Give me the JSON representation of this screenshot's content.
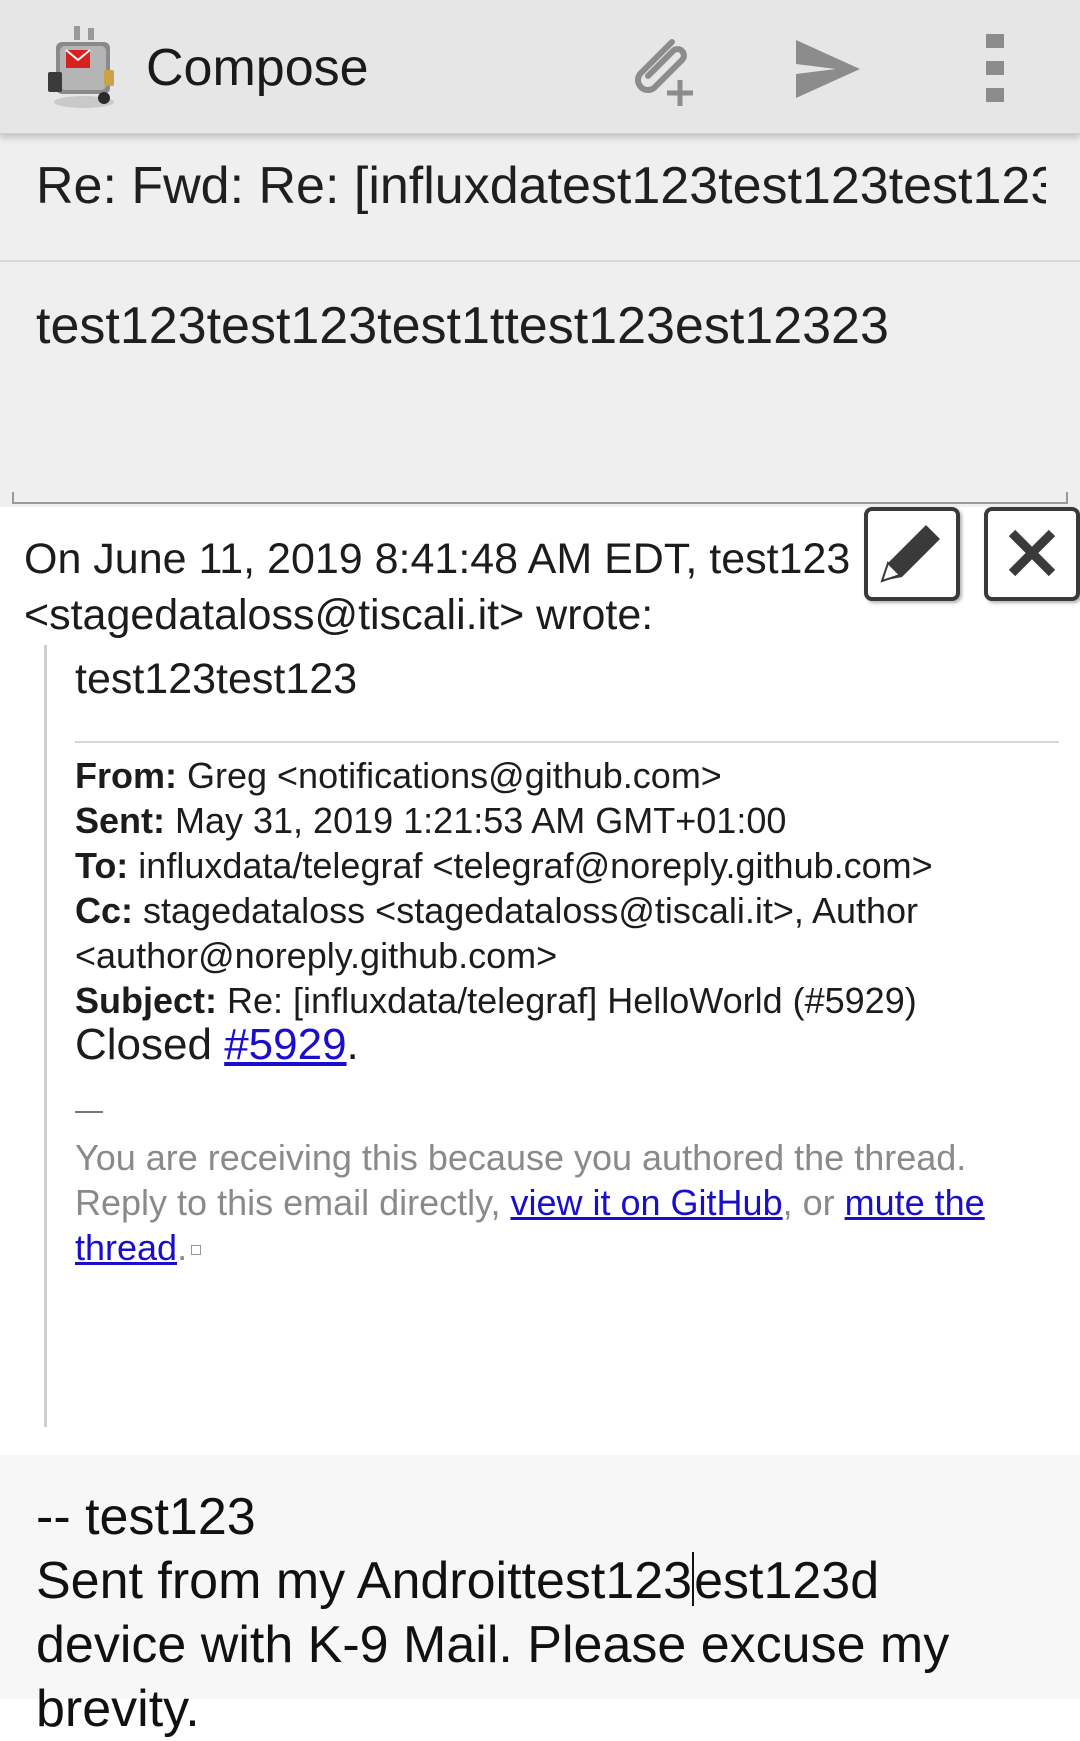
{
  "appbar": {
    "title": "Compose",
    "icons": {
      "app": "k9-mail-robot-icon",
      "attach": "attach-plus-icon",
      "send": "send-icon",
      "more": "more-vert-icon"
    }
  },
  "subject": {
    "value": "Re: Fwd: Re: [influxdatest123test123test123"
  },
  "body": {
    "value": "test123test123test1ttest123est12323"
  },
  "quote": {
    "header_line1": "On June 11, 2019 8:41:48 AM EDT, test123",
    "header_line2": "<stagedataloss@tiscali.it> wrote:",
    "first_line": "test123test123",
    "from_label": "From:",
    "from_value": " Greg <notifications@github.com>",
    "sent_label": "Sent:",
    "sent_value": " May 31, 2019 1:21:53 AM GMT+01:00",
    "to_label": "To:",
    "to_value": " influxdata/telegraf <telegraf@noreply.github.com>",
    "cc_label": "Cc:",
    "cc_value_line1": " stagedataloss <stagedataloss@tiscali.it>, Author",
    "cc_value_line2": "<author@noreply.github.com>",
    "subject_label": "Subject:",
    "subject_value": " Re: [influxdata/telegraf] HelloWorld (#5929)",
    "closed_prefix": "Closed ",
    "closed_link": "#5929",
    "closed_suffix": ".",
    "note_line1": "You are receiving this because you authored the thread.",
    "note_line2_prefix": "Reply to this email directly, ",
    "note_link1": "view it on GitHub",
    "note_middle": ", or ",
    "note_link2a": "mute the",
    "note_link2b": "thread",
    "note_end": "."
  },
  "signature": {
    "line1": "-- test123",
    "line2_before_cursor": "Sent from my Androittest123",
    "line2_after_cursor": "est123d",
    "line3": "device with K-9 Mail. Please excuse my",
    "line4": "brevity."
  }
}
